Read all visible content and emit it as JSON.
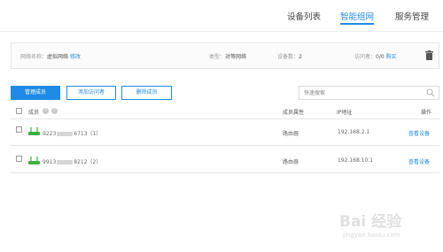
{
  "nav": {
    "tabs": [
      {
        "label": "设备列表",
        "active": false
      },
      {
        "label": "智能组网",
        "active": true
      },
      {
        "label": "服务管理",
        "active": false
      }
    ]
  },
  "info": {
    "network_name_label": "网络名称：",
    "network_name": "虚拟网络",
    "edit_link": "修改",
    "type_label": "类型：",
    "type_value": "对等网络",
    "device_count_label": "设备数：",
    "device_count": "2",
    "visitor_label": "访问者：",
    "visitor_value": "0/0",
    "buy_link": "购买"
  },
  "toolbar": {
    "manage_members": "管理成员",
    "add_visitor": "添加访问者",
    "delete_member": "删除成员",
    "search_placeholder": "快速搜索"
  },
  "table": {
    "headers": {
      "member": "成员",
      "attribute": "成员属性",
      "ip": "IP地址",
      "action": "操作"
    },
    "rows": [
      {
        "id_prefix": "9223",
        "id_suffix": "6713（1）",
        "attribute": "路由器",
        "ip": "192.168.2.1",
        "action": "查看设备"
      },
      {
        "id_prefix": "9913",
        "id_suffix": "8212（2）",
        "attribute": "路由器",
        "ip": "192.168.10.1",
        "action": "查看设备"
      }
    ]
  },
  "watermark": {
    "text": "Bai 经验",
    "sub": "jingyan.baidu.com"
  },
  "colors": {
    "accent": "#1f8be6",
    "router_icon": "#3cb043"
  }
}
